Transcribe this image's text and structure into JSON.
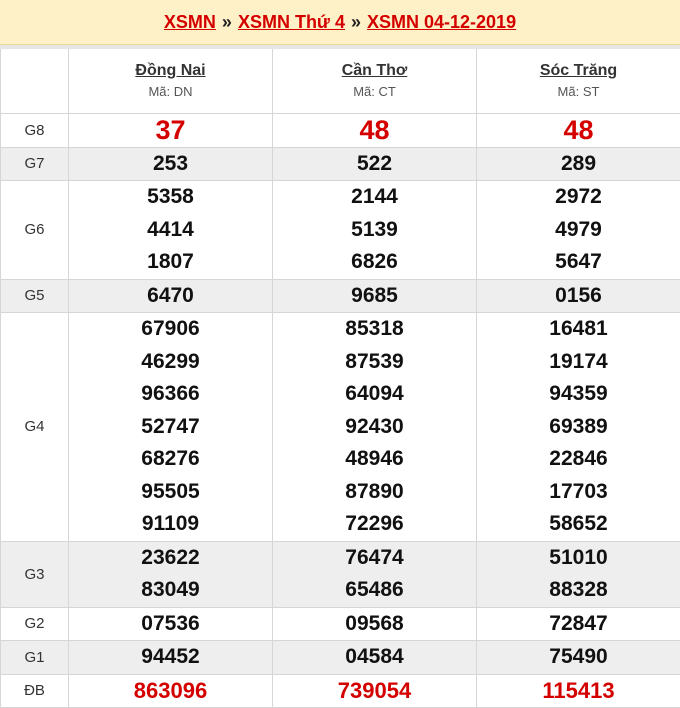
{
  "breadcrumb": {
    "item1": "XSMN",
    "item2": "XSMN Thứ 4",
    "item3": "XSMN 04-12-2019",
    "separator": "»"
  },
  "provinces": [
    {
      "name": "Đồng Nai",
      "code": "Mã: DN"
    },
    {
      "name": "Cần Thơ",
      "code": "Mã: CT"
    },
    {
      "name": "Sóc Trăng",
      "code": "Mã: ST"
    }
  ],
  "prizes": [
    {
      "label": "G8",
      "values": [
        [
          "37"
        ],
        [
          "48"
        ],
        [
          "48"
        ]
      ]
    },
    {
      "label": "G7",
      "values": [
        [
          "253"
        ],
        [
          "522"
        ],
        [
          "289"
        ]
      ]
    },
    {
      "label": "G6",
      "values": [
        [
          "5358",
          "4414",
          "1807"
        ],
        [
          "2144",
          "5139",
          "6826"
        ],
        [
          "2972",
          "4979",
          "5647"
        ]
      ]
    },
    {
      "label": "G5",
      "values": [
        [
          "6470"
        ],
        [
          "9685"
        ],
        [
          "0156"
        ]
      ]
    },
    {
      "label": "G4",
      "values": [
        [
          "67906",
          "46299",
          "96366",
          "52747",
          "68276",
          "95505",
          "91109"
        ],
        [
          "85318",
          "87539",
          "64094",
          "92430",
          "48946",
          "87890",
          "72296"
        ],
        [
          "16481",
          "19174",
          "94359",
          "69389",
          "22846",
          "17703",
          "58652"
        ]
      ]
    },
    {
      "label": "G3",
      "values": [
        [
          "23622",
          "83049"
        ],
        [
          "76474",
          "65486"
        ],
        [
          "51010",
          "88328"
        ]
      ]
    },
    {
      "label": "G2",
      "values": [
        [
          "07536"
        ],
        [
          "09568"
        ],
        [
          "72847"
        ]
      ]
    },
    {
      "label": "G1",
      "values": [
        [
          "94452"
        ],
        [
          "04584"
        ],
        [
          "75490"
        ]
      ]
    },
    {
      "label": "ĐB",
      "values": [
        [
          "863096"
        ],
        [
          "739054"
        ],
        [
          "115413"
        ]
      ]
    }
  ],
  "colors": {
    "banner_bg": "#fff1c7",
    "link_red": "#d40000",
    "alt_row": "#eeeeee"
  }
}
